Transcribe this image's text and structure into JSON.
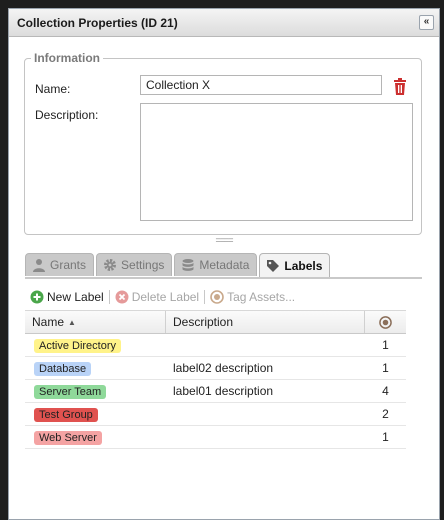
{
  "window": {
    "title": "Collection Properties (ID 21)",
    "collapse_glyph": "«"
  },
  "info": {
    "legend": "Information",
    "name_label": "Name:",
    "name_value": "Collection X",
    "description_label": "Description:",
    "description_value": ""
  },
  "splitter": "====",
  "tabs": [
    {
      "label": "Grants",
      "icon": "user-icon",
      "active": false
    },
    {
      "label": "Settings",
      "icon": "gear-icon",
      "active": false
    },
    {
      "label": "Metadata",
      "icon": "database-icon",
      "active": false
    },
    {
      "label": "Labels",
      "icon": "tag-icon",
      "active": true
    }
  ],
  "toolbar": {
    "new_label": "New Label",
    "delete_label": "Delete Label",
    "tag_assets": "Tag Assets..."
  },
  "grid": {
    "columns": {
      "name": "Name",
      "description": "Description",
      "count_icon": "target-icon"
    },
    "rows": [
      {
        "name": "Active Directory",
        "color": "#fff38a",
        "description": "",
        "count": "1"
      },
      {
        "name": "Database",
        "color": "#b9d3f7",
        "description": "label02 description",
        "count": "1"
      },
      {
        "name": "Server Team",
        "color": "#8fd99a",
        "description": "label01 description",
        "count": "4"
      },
      {
        "name": "Test Group",
        "color": "#e0524f",
        "description": "",
        "count": "2"
      },
      {
        "name": "Web Server",
        "color": "#f4a3a3",
        "description": "",
        "count": "1"
      }
    ]
  }
}
